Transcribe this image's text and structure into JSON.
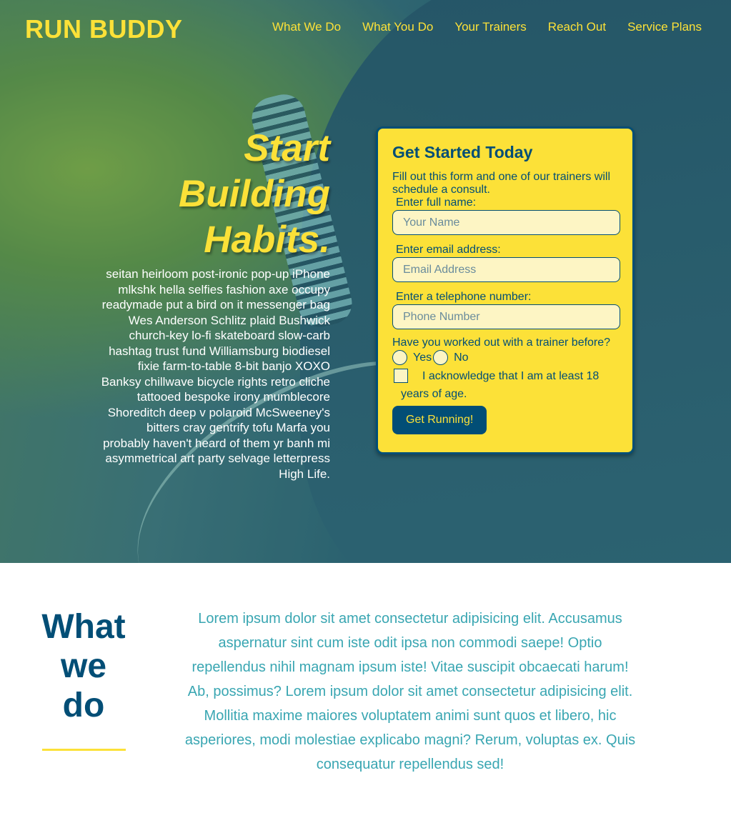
{
  "header": {
    "logo": "RUN BUDDY",
    "nav": [
      "What We Do",
      "What You Do",
      "Your Trainers",
      "Reach Out",
      "Service Plans"
    ]
  },
  "hero": {
    "headline": "Start Building Habits.",
    "body": "seitan heirloom post-ironic pop-up iPhone mlkshk hella selfies fashion axe occupy readymade put a bird on it messenger bag Wes Anderson Schlitz plaid Bushwick church-key lo-fi skateboard slow-carb hashtag trust fund Williamsburg biodiesel fixie farm-to-table 8-bit banjo XOXO Banksy chillwave bicycle rights retro cliche tattooed bespoke irony mumblecore Shoreditch deep v polaroid McSweeney's bitters cray gentrify tofu Marfa you probably haven't heard of them yr banh mi asymmetrical art party selvage letterpress High Life."
  },
  "form": {
    "title": "Get Started Today",
    "intro": "Fill out this form and one of our trainers will schedule a consult.",
    "name_label": "Enter full name:",
    "name_placeholder": "Your Name",
    "email_label": "Enter email address:",
    "email_placeholder": "Email Address",
    "phone_label": "Enter a telephone number:",
    "phone_placeholder": "Phone Number",
    "question": "Have you worked out with a trainer before?",
    "yes_label": "Yes",
    "no_label": "No",
    "ack_label": "I acknowledge that I am at least 18 years of age.",
    "submit_label": "Get Running!"
  },
  "what_we_do": {
    "title": "What we do",
    "text": "Lorem ipsum dolor sit amet consectetur adipisicing elit. Accusamus aspernatur sint cum iste odit ipsa non commodi saepe! Optio repellendus nihil magnam ipsum iste! Vitae suscipit obcaecati harum! Ab, possimus? Lorem ipsum dolor sit amet consectetur adipisicing elit. Mollitia maxime maiores voluptatem animi sunt quos et libero, hic asperiores, modi molestiae explicabo magni? Rerum, voluptas ex. Quis consequatur repellendus sed!"
  },
  "colors": {
    "brand_yellow": "#fce138",
    "brand_navy": "#024e76",
    "teal_text": "#39a6b2"
  }
}
